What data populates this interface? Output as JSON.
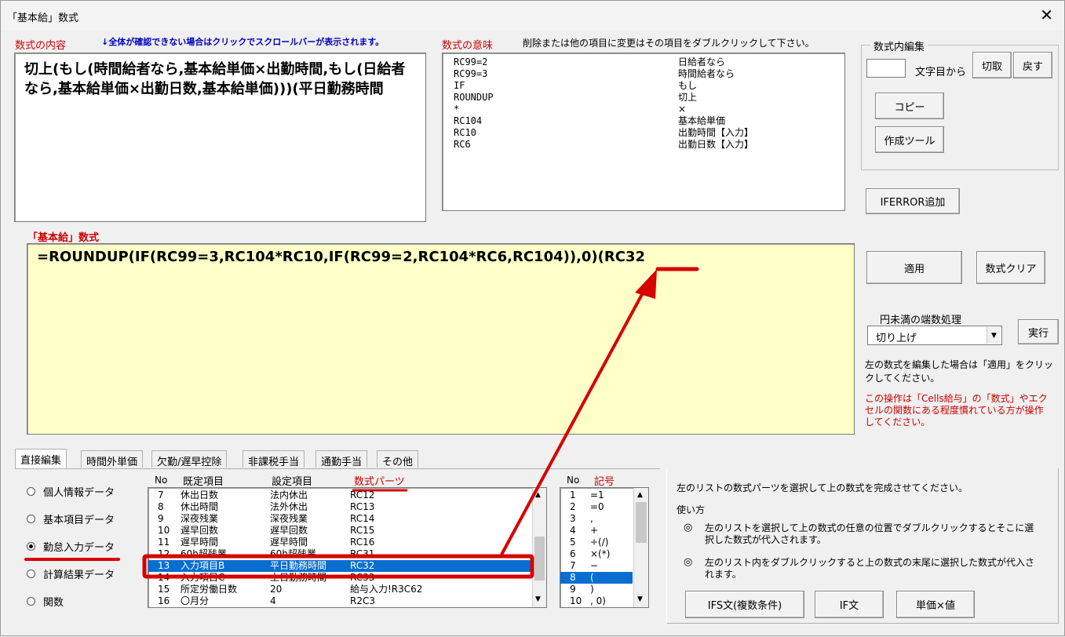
{
  "window": {
    "title": "「基本給」数式",
    "close": "✕"
  },
  "formula_content": {
    "label": "数式の内容",
    "hint": "↓全体が確認できない場合はクリックでスクロールバーが表示されます。",
    "text": "切上(もし(時間給者なら,基本給単価×出勤時間,もし(日給者なら,基本給単価×出勤日数,基本給単価)))(平日勤務時間"
  },
  "formula_meaning": {
    "label": "数式の意味",
    "hint": "削除または他の項目に変更はその項目をダブルクリックして下さい。",
    "rows": [
      {
        "code": "RC99=2",
        "meaning": "日給者なら"
      },
      {
        "code": "RC99=3",
        "meaning": "時間給者なら"
      },
      {
        "code": "IF",
        "meaning": "もし"
      },
      {
        "code": "ROUNDUP",
        "meaning": "切上"
      },
      {
        "code": "*",
        "meaning": "×"
      },
      {
        "code": "RC104",
        "meaning": "基本給単価"
      },
      {
        "code": "RC10",
        "meaning": "出勤時間【入力】"
      },
      {
        "code": "RC6",
        "meaning": "出勤日数【入力】"
      }
    ]
  },
  "edit_group": {
    "label": "数式内編集",
    "char_pos_input": "",
    "char_pos_label": "文字目から",
    "cut": "切取",
    "undo": "戻す",
    "copy": "コピー",
    "tool": "作成ツール"
  },
  "iferror_button": "IFERROR追加",
  "formula_editor": {
    "label": "「基本給」数式",
    "text": "=ROUNDUP(IF(RC99=3,RC104*RC10,IF(RC99=2,RC104*RC6,RC104)),0)(RC32"
  },
  "apply_button": "適用",
  "clear_button": "数式クリア",
  "rounding": {
    "label": "円未満の端数処理",
    "selected": "切り上げ",
    "run": "実行"
  },
  "note_black": "左の数式を編集した場合は「適用」をクリックしてください。",
  "note_red": "この操作は「Cells給与」の「数式」やエクセルの関数にある程度慣れている方が操作してください。",
  "tabs": [
    "直接編集",
    "時間外単価",
    "欠勤/遅早控除",
    "非課税手当",
    "通勤手当",
    "その他"
  ],
  "radios": [
    {
      "label": "個人情報データ",
      "checked": false
    },
    {
      "label": "基本項目データ",
      "checked": false
    },
    {
      "label": "勤怠入力データ",
      "checked": true
    },
    {
      "label": "計算結果データ",
      "checked": false
    },
    {
      "label": "関数",
      "checked": false
    }
  ],
  "parts_list": {
    "headers": {
      "no": "No",
      "default": "既定項目",
      "setting": "設定項目",
      "parts": "数式パーツ"
    },
    "rows": [
      {
        "no": "7",
        "default": "休出日数",
        "setting": "法内休出",
        "parts": "RC12"
      },
      {
        "no": "8",
        "default": "休出時間",
        "setting": "法外休出",
        "parts": "RC13"
      },
      {
        "no": "9",
        "default": "深夜残業",
        "setting": "深夜残業",
        "parts": "RC14"
      },
      {
        "no": "10",
        "default": "遅早回数",
        "setting": "遅早回数",
        "parts": "RC15"
      },
      {
        "no": "11",
        "default": "遅早時間",
        "setting": "遅早時間",
        "parts": "RC16"
      },
      {
        "no": "12",
        "default": "60h超残業",
        "setting": "60h超残業",
        "parts": "RC31"
      },
      {
        "no": "13",
        "default": "入力項目B",
        "setting": "平日勤務時間",
        "parts": "RC32"
      },
      {
        "no": "14",
        "default": "入力項目C",
        "setting": "土日勤務時間",
        "parts": "RC33"
      },
      {
        "no": "15",
        "default": "所定労働日数",
        "setting": "20",
        "parts": "給与入力!R3C62"
      },
      {
        "no": "16",
        "default": "〇月分",
        "setting": "4",
        "parts": "R2C3"
      }
    ],
    "selected_index": 6
  },
  "symbols_list": {
    "headers": {
      "no": "No",
      "symbol": "記号"
    },
    "rows": [
      {
        "no": "1",
        "sym": "=1"
      },
      {
        "no": "2",
        "sym": "=0"
      },
      {
        "no": "3",
        "sym": ","
      },
      {
        "no": "4",
        "sym": "+"
      },
      {
        "no": "5",
        "sym": "÷(/)"
      },
      {
        "no": "6",
        "sym": "×(*)"
      },
      {
        "no": "7",
        "sym": "−"
      },
      {
        "no": "8",
        "sym": "("
      },
      {
        "no": "9",
        "sym": ")"
      },
      {
        "no": "10",
        "sym": ", 0)"
      }
    ],
    "selected_index": 7
  },
  "instructions": {
    "intro": "左のリストの数式パーツを選択して上の数式を完成させてください。",
    "howto": "使い方",
    "item1": "左のリストを選択して上の数式の任意の位置でダブルクリックするとそこに選択した数式が代入されます。",
    "item2": "左のリスト内をダブルクリックすると上の数式の末尾に選択した数式が代入されます。"
  },
  "bottom_buttons": {
    "ifs": "IFS文(複数条件)",
    "if": "IF文",
    "unit": "単価×値"
  },
  "colors": {
    "highlight": "#0a6ed1",
    "accent_red": "#d60000",
    "editor_bg": "#ffffc8"
  }
}
